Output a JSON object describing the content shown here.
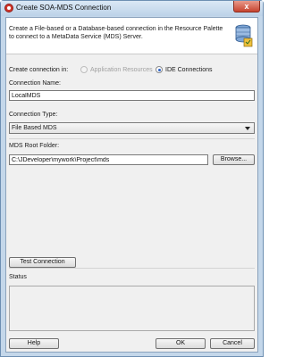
{
  "window": {
    "title": "Create SOA-MDS Connection",
    "close_glyph": "x"
  },
  "header": {
    "description": "Create a File-based or a Database-based connection in the Resource Palette to connect to a MetaData Service (MDS) Server."
  },
  "create_in": {
    "label": "Create connection in:",
    "options": [
      {
        "label": "Application Resources",
        "selected": false,
        "enabled": false
      },
      {
        "label": "IDE Connections",
        "selected": true,
        "enabled": true
      }
    ]
  },
  "connection_name": {
    "label": "Connection Name:",
    "value": "LocalMDS"
  },
  "connection_type": {
    "label": "Connection Type:",
    "value": "File Based MDS"
  },
  "mds_root": {
    "label": "MDS Root Folder:",
    "value": "C:\\JDeveloper\\mywork\\Project\\mds",
    "browse_label": "Browse..."
  },
  "test_connection_label": "Test Connection",
  "status_label": "Status",
  "footer": {
    "help_label": "Help",
    "ok_label": "OK",
    "cancel_label": "Cancel"
  },
  "colors": {
    "title_bar": "#bcd2e8",
    "close_button": "#c7432e",
    "dialog_bg": "#f0f0f0"
  },
  "icons": [
    "soa-app-icon",
    "close-icon",
    "database-connection-icon",
    "dropdown-arrow-icon"
  ]
}
